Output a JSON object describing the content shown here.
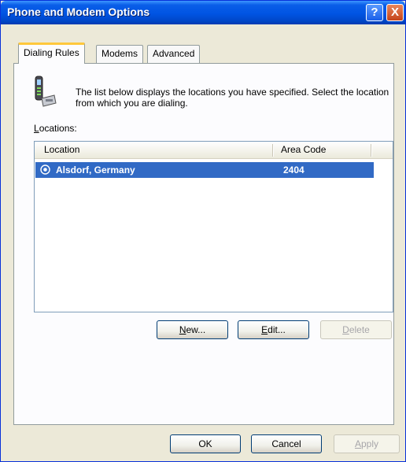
{
  "window": {
    "title": "Phone and Modem Options"
  },
  "titlebar_buttons": {
    "help": "?",
    "close": "X"
  },
  "tabs": [
    {
      "label": "Dialing Rules",
      "active": true
    },
    {
      "label": "Modems",
      "active": false
    },
    {
      "label": "Advanced",
      "active": false
    }
  ],
  "description": "The list below displays the locations you have specified. Select the location from which you are dialing.",
  "locations_label": {
    "mnemonic": "L",
    "rest": "ocations:"
  },
  "list": {
    "columns": [
      "Location",
      "Area Code"
    ],
    "rows": [
      {
        "location": "Alsdorf, Germany",
        "area_code": "2404",
        "selected": true
      }
    ]
  },
  "list_buttons": {
    "new": {
      "mnemonic": "N",
      "rest": "ew...",
      "enabled": true
    },
    "edit": {
      "mnemonic": "E",
      "rest": "dit...",
      "enabled": true
    },
    "delete": {
      "mnemonic": "D",
      "rest": "elete",
      "enabled": false
    }
  },
  "dialog_buttons": {
    "ok": "OK",
    "cancel": "Cancel",
    "apply": {
      "mnemonic": "A",
      "rest": "pply",
      "enabled": false
    }
  },
  "icons": {
    "location_row": "radio-selected-icon",
    "header": "phone-icon"
  },
  "colors": {
    "titlebar": "#0054e3",
    "selection": "#316ac5",
    "tab_highlight": "#ffc83c",
    "dialog_bg": "#ece9d8"
  }
}
